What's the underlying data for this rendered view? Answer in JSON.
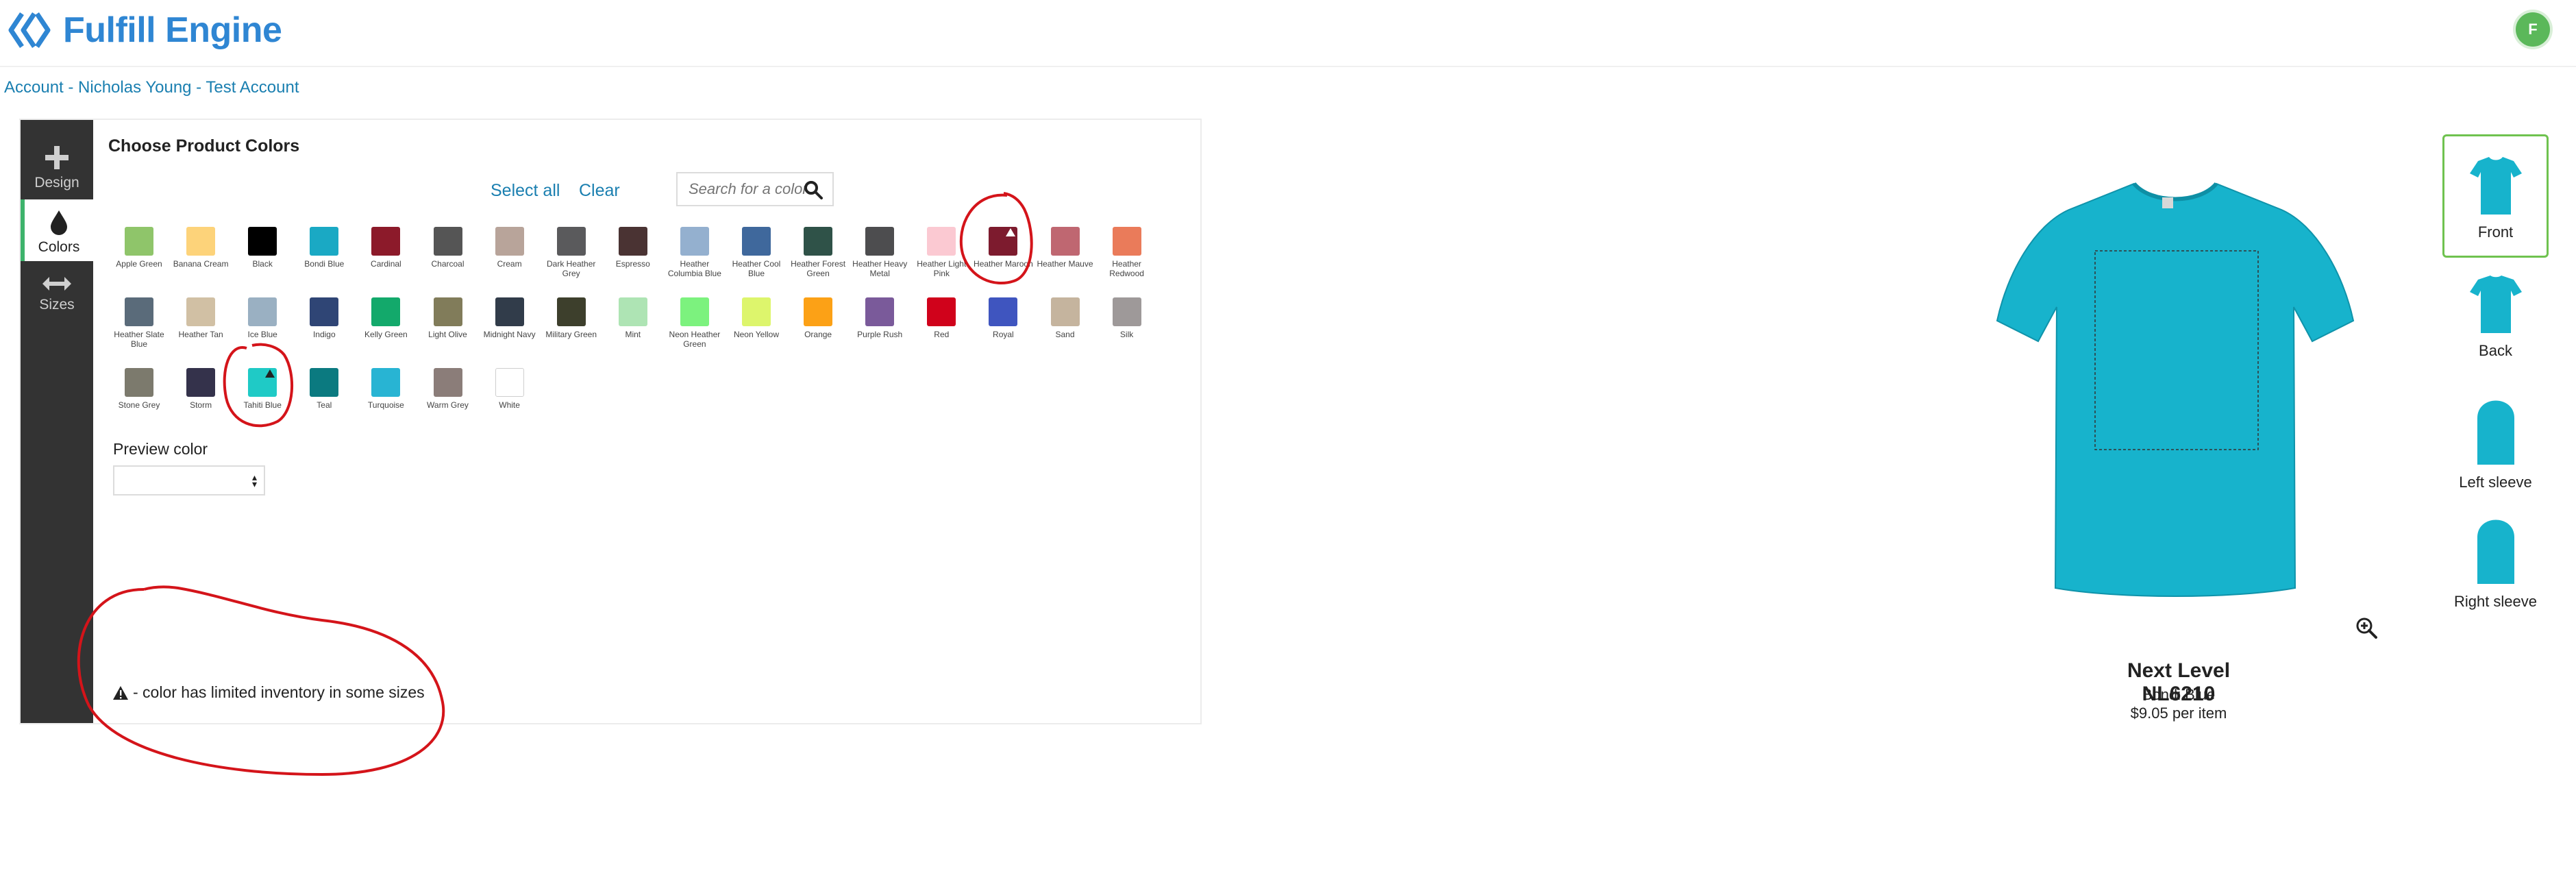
{
  "app": {
    "name": "Fulfill Engine",
    "avatar_initial": "F"
  },
  "breadcrumb": "Account - Nicholas Young - Test Account",
  "sidenav": [
    {
      "label": "Design",
      "icon": "plus-icon"
    },
    {
      "label": "Colors",
      "icon": "droplet-icon",
      "active": true
    },
    {
      "label": "Sizes",
      "icon": "horizontal-arrows-icon"
    }
  ],
  "colors_panel": {
    "title": "Choose Product Colors",
    "select_all": "Select all",
    "clear": "Clear",
    "search_placeholder": "Search for a color",
    "swatches": [
      {
        "name": "Apple Green",
        "hex": "#8fc56a"
      },
      {
        "name": "Banana Cream",
        "hex": "#fdd37a"
      },
      {
        "name": "Black",
        "hex": "#000000"
      },
      {
        "name": "Bondi Blue",
        "hex": "#1aa9c4"
      },
      {
        "name": "Cardinal",
        "hex": "#8c1a2a"
      },
      {
        "name": "Charcoal",
        "hex": "#555555"
      },
      {
        "name": "Cream",
        "hex": "#b8a49a"
      },
      {
        "name": "Dark Heather Grey",
        "hex": "#5a5a5c"
      },
      {
        "name": "Espresso",
        "hex": "#4a3333"
      },
      {
        "name": "Heather Columbia Blue",
        "hex": "#94b0cf"
      },
      {
        "name": "Heather Cool Blue",
        "hex": "#3f689c"
      },
      {
        "name": "Heather Forest Green",
        "hex": "#2f5248"
      },
      {
        "name": "Heather Heavy Metal",
        "hex": "#4d4d4f"
      },
      {
        "name": "Heather Light Pink",
        "hex": "#fbc9d2"
      },
      {
        "name": "Heather Maroon",
        "hex": "#7d1b2e",
        "limited": true
      },
      {
        "name": "Heather Mauve",
        "hex": "#bf6771"
      },
      {
        "name": "Heather Redwood",
        "hex": "#ea7b5a"
      },
      {
        "name": "Heather Slate Blue",
        "hex": "#5a6b7a"
      },
      {
        "name": "Heather Tan",
        "hex": "#d1c0a4"
      },
      {
        "name": "Ice Blue",
        "hex": "#9ab0c2"
      },
      {
        "name": "Indigo",
        "hex": "#2f4575"
      },
      {
        "name": "Kelly Green",
        "hex": "#13a96b"
      },
      {
        "name": "Light Olive",
        "hex": "#817c5a"
      },
      {
        "name": "Midnight Navy",
        "hex": "#313c4a"
      },
      {
        "name": "Military Green",
        "hex": "#3d3f2c"
      },
      {
        "name": "Mint",
        "hex": "#aee4b4"
      },
      {
        "name": "Neon Heather Green",
        "hex": "#7cf27e"
      },
      {
        "name": "Neon Yellow",
        "hex": "#ddf56c"
      },
      {
        "name": "Orange",
        "hex": "#fca116"
      },
      {
        "name": "Purple Rush",
        "hex": "#7a5a9a"
      },
      {
        "name": "Red",
        "hex": "#d0021b"
      },
      {
        "name": "Royal",
        "hex": "#3f55bf"
      },
      {
        "name": "Sand",
        "hex": "#c5b49e"
      },
      {
        "name": "Silk",
        "hex": "#9e9999"
      },
      {
        "name": "Stone Grey",
        "hex": "#7c7a6d"
      },
      {
        "name": "Storm",
        "hex": "#34324b"
      },
      {
        "name": "Tahiti Blue",
        "hex": "#1fcac6",
        "limited": true
      },
      {
        "name": "Teal",
        "hex": "#0b7a80"
      },
      {
        "name": "Turquoise",
        "hex": "#28b4d3"
      },
      {
        "name": "Warm Grey",
        "hex": "#8b7d79"
      },
      {
        "name": "White",
        "hex": "#ffffff"
      }
    ],
    "preview_label": "Preview color",
    "preview_value": "",
    "legend_text": "- color has limited inventory in some sizes"
  },
  "preview": {
    "shirt_color": "#17b3cc",
    "product_name": "Next Level NL6210",
    "color_name": "Bondi Blue",
    "price": "$9.05 per item",
    "views": [
      {
        "label": "Front",
        "active": true
      },
      {
        "label": "Back"
      },
      {
        "label": "Left sleeve"
      },
      {
        "label": "Right sleeve"
      }
    ]
  }
}
